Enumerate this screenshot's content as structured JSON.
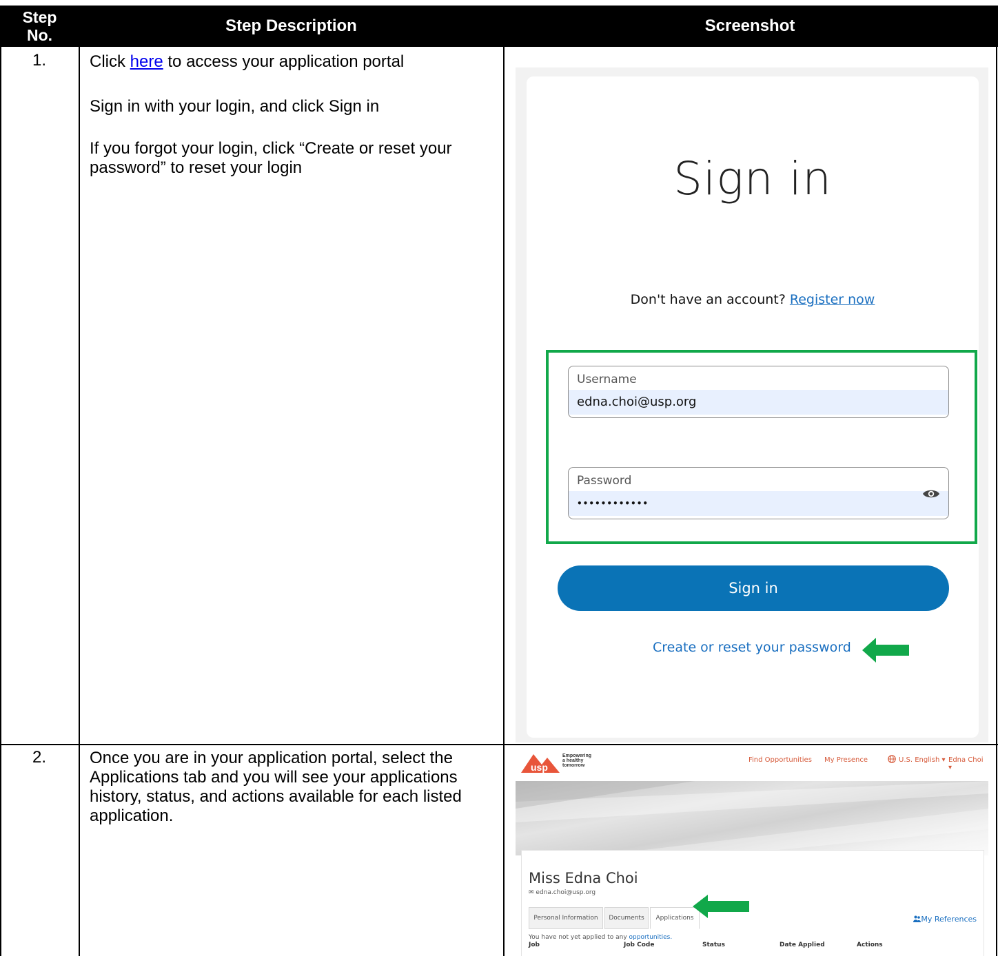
{
  "table": {
    "headers": {
      "step_no_line1": "Step",
      "step_no_line2": "No.",
      "description": "Step Description",
      "screenshot": "Screenshot"
    },
    "rows": [
      {
        "number": "1.",
        "lines": [
          {
            "prefix": "Click ",
            "link": "here",
            "suffix": " to access your application portal"
          },
          {
            "text": "Sign in with your login, and click Sign in"
          },
          {
            "text": "If you forgot your login, click “Create or reset your password” to reset your login"
          }
        ]
      },
      {
        "number": "2.",
        "text": "Once you are in your application portal, select the Applications tab and you will see your applications history, status, and actions available for each listed application."
      }
    ]
  },
  "signin_screen": {
    "title": "Sign in",
    "no_account_text": "Don't have an account?",
    "register_link": "Register now",
    "username_label": "Username",
    "username_value": "edna.choi@usp.org",
    "password_label": "Password",
    "password_value": "••••••••••••",
    "signin_button": "Sign in",
    "reset_link": "Create or reset your password",
    "highlight_color": "#11a84a",
    "button_color": "#0a73b6"
  },
  "portal_screen": {
    "logo_text": "usp",
    "tagline": "Empowering a healthy tomorrow",
    "nav": {
      "find_opportunities": "Find Opportunities",
      "my_presence": "My Presence",
      "language": "U.S. English ▾",
      "user_menu": "Edna Choi ▾"
    },
    "profile_name": "Miss Edna Choi",
    "profile_email": "✉ edna.choi@usp.org",
    "tabs": [
      "Personal Information",
      "Documents",
      "Applications"
    ],
    "my_references": "My References",
    "empty_prefix": "You have not yet applied to any ",
    "empty_link": "opportunities.",
    "columns": [
      "Job",
      "Job Code",
      "Status",
      "Date Applied",
      "Actions"
    ],
    "accent_color": "#e8553a"
  }
}
